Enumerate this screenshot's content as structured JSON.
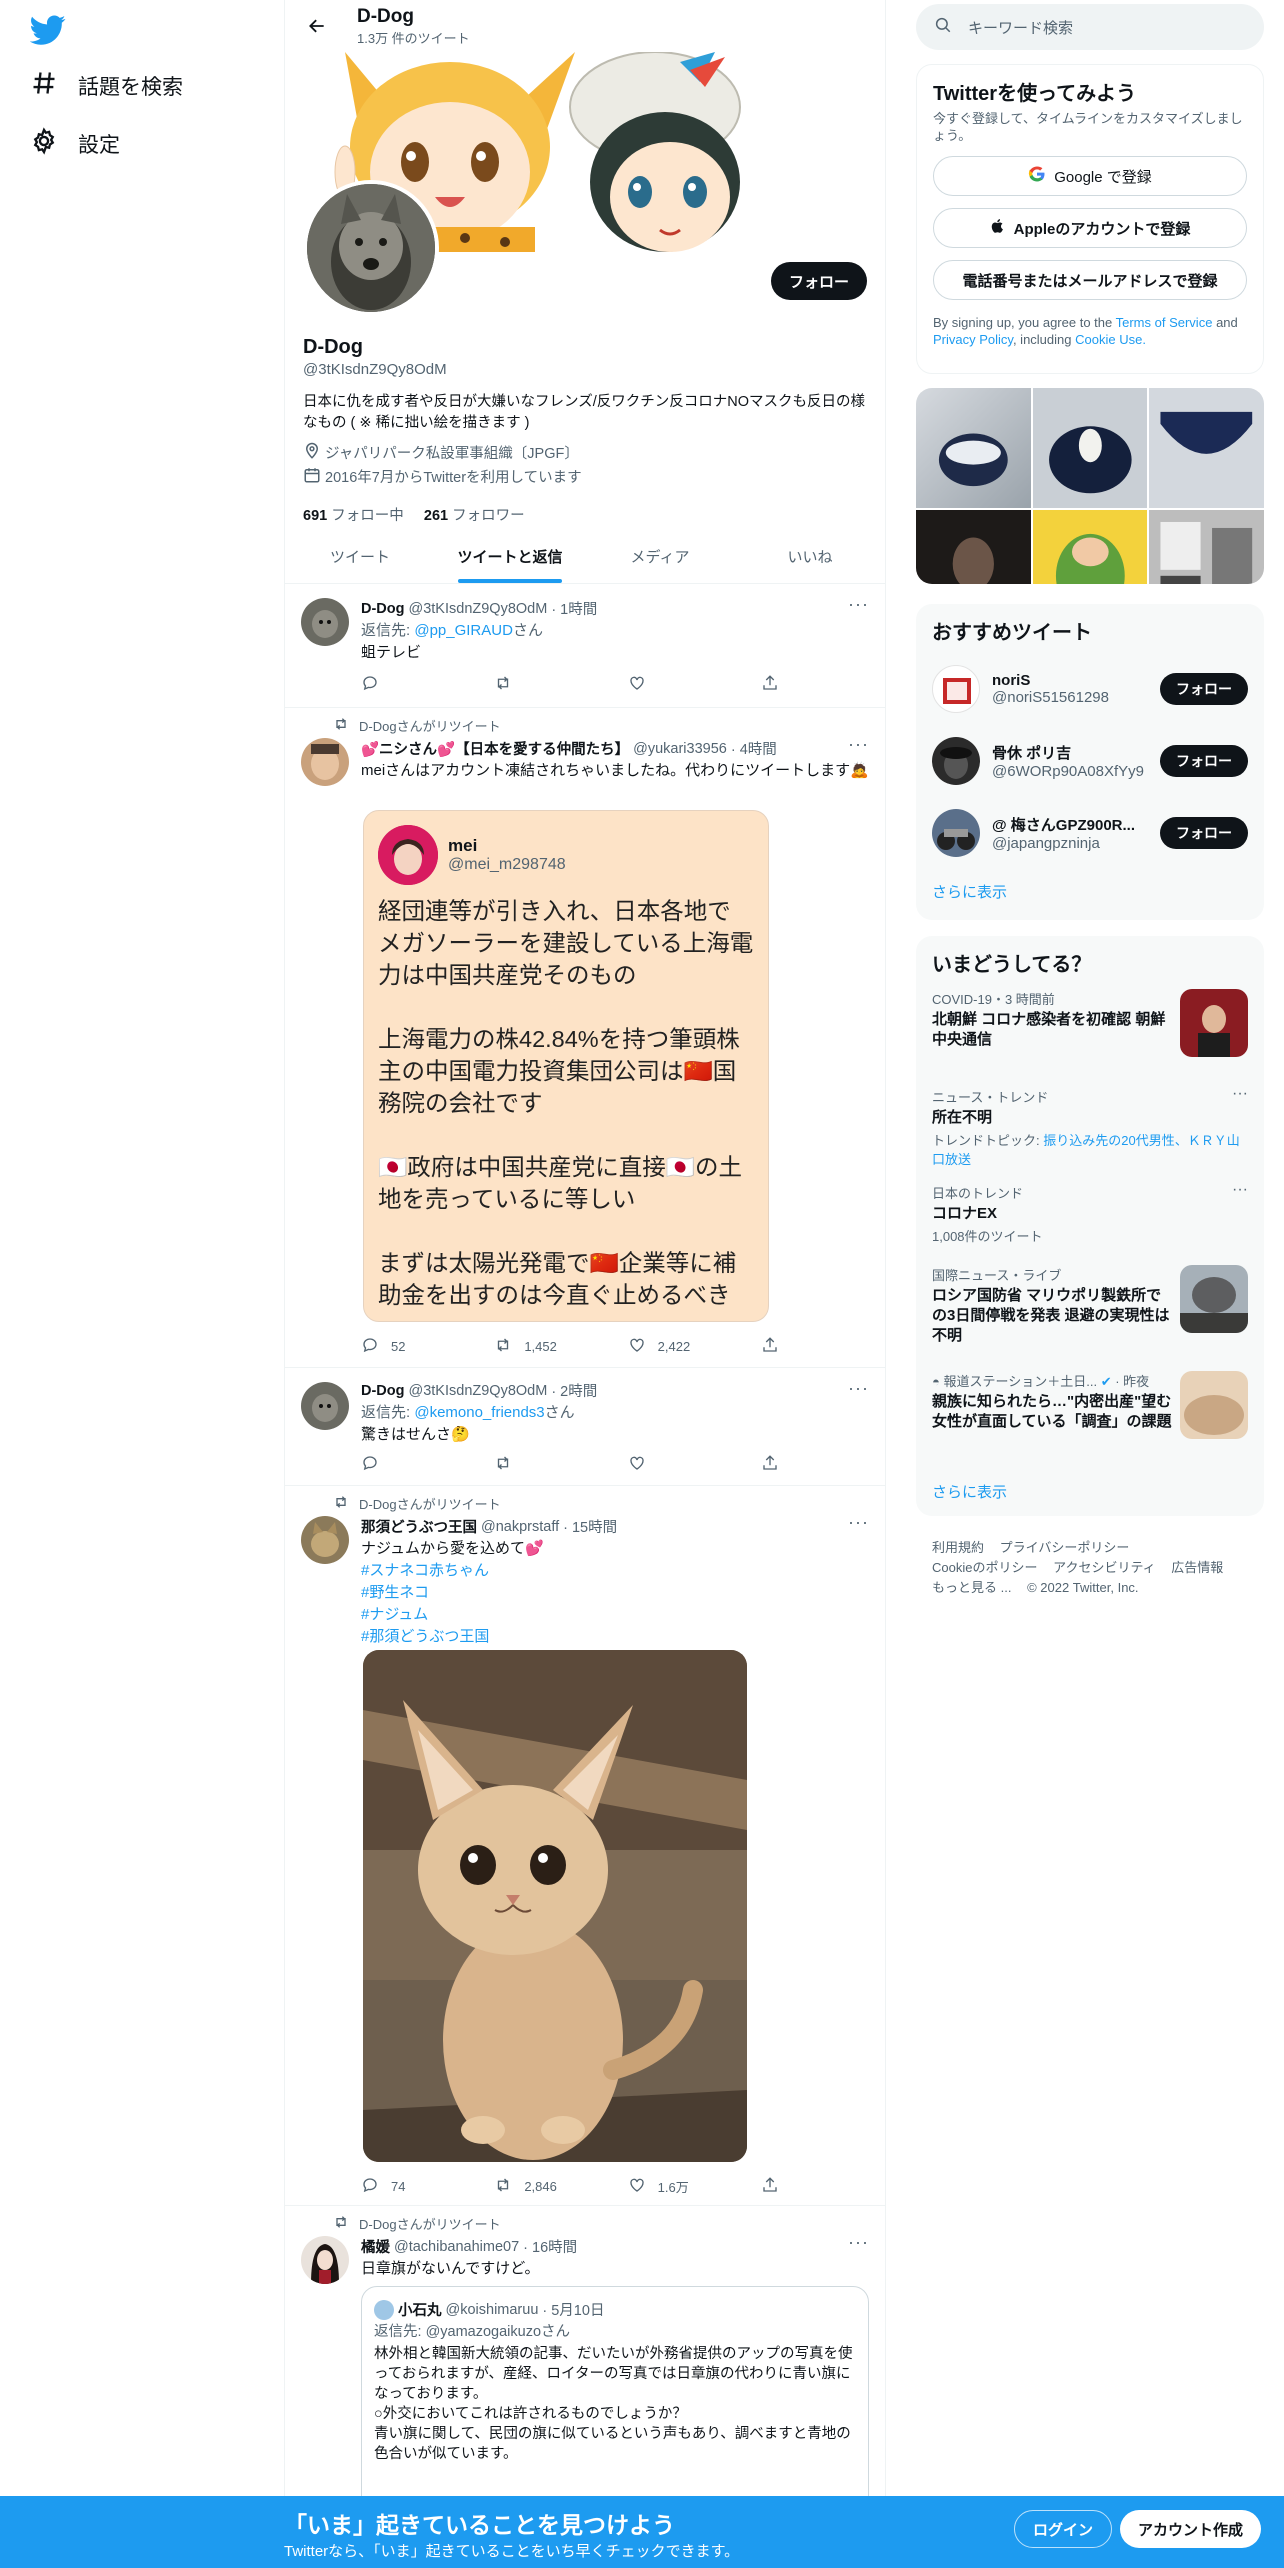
{
  "nav": {
    "explore_label": "話題を検索",
    "settings_label": "設定"
  },
  "profile": {
    "header_name": "D-Dog",
    "tweet_count": "1.3万 件のツイート",
    "name": "D-Dog",
    "handle": "@3tKIsdnZ9Qy8OdM",
    "follow_label": "フォロー",
    "bio": "日本に仇を成す者や反日が大嫌いなフレンズ/反ワクチン反コロナNOマスクも反日の様なもの ( ※ 稀に拙い絵を描きます )",
    "location": "ジャパリパーク私設軍事組織〔JPGF〕",
    "joined": "2016年7月からTwitterを利用しています",
    "following_count": "691",
    "following_label": "フォロー中",
    "followers_count": "261",
    "followers_label": "フォロワー"
  },
  "tabs": [
    "ツイート",
    "ツイートと返信",
    "メディア",
    "いいね"
  ],
  "tweets": [
    {
      "name": "D-Dog",
      "handle": "@3tKIsdnZ9Qy8OdM",
      "time": "· 1時間",
      "reply_prefix": "返信先:",
      "reply_to": "@pp_GIRAUD",
      "reply_suffix": "さん",
      "text": "蛆テレビ"
    },
    {
      "retweet_by": "D-Dogさんがリツイート",
      "name": "💕ニシさん💕【日本を愛する仲間たち】",
      "handle": "@yukari33956",
      "time": "· 4時間",
      "text": "meiさんはアカウント凍結されちゃいましたね。代わりにツイートします🙇",
      "embed_name": "mei",
      "embed_handle": "@mei_m298748",
      "embed_text_1": "経団連等が引き入れ、日本各地でメガソーラーを建設している上海電力は中国共産党そのもの",
      "embed_text_2": "上海電力の株42.84%を持つ筆頭株主の中国電力投資集団公司は🇨🇳国務院の会社です",
      "embed_text_3": "🇯🇵政府は中国共産党に直接🇯🇵の土地を売っているに等しい",
      "embed_text_4": "まずは太陽光発電で🇨🇳企業等に補助金を出すのは今直ぐ止めるべき",
      "replies": "52",
      "retweets": "1,452",
      "likes": "2,422"
    },
    {
      "name": "D-Dog",
      "handle": "@3tKIsdnZ9Qy8OdM",
      "time": "· 2時間",
      "reply_prefix": "返信先:",
      "reply_to": "@kemono_friends3",
      "reply_suffix": "さん",
      "text": "驚きはせんさ🤔"
    },
    {
      "retweet_by": "D-Dogさんがリツイート",
      "name": "那須どうぶつ王国",
      "handle": "@nakprstaff",
      "time": "· 15時間",
      "text": "ナジュムから愛を込めて💕",
      "hashtags": [
        "#スナネコ赤ちゃん",
        "#野生ネコ",
        "#ナジュム",
        "#那須どうぶつ王国"
      ],
      "replies": "74",
      "retweets": "2,846",
      "likes": "1.6万"
    },
    {
      "retweet_by": "D-Dogさんがリツイート",
      "name": "橘媛",
      "handle": "@tachibanahime07",
      "time": "· 16時間",
      "text": "日章旗がないんですけど。",
      "quote_name": "小石丸",
      "quote_handle": "@koishimaruu",
      "quote_time": "· 5月10日",
      "quote_reply_prefix": "返信先:",
      "quote_reply_to": "@yamazogaikuzo",
      "quote_reply_suffix": "さん",
      "quote_text": "林外相と韓国新大統領の記事、だいたいが外務省提供のアップの写真を使っておられますが、産経、ロイターの写真では日章旗の代わりに青い旗になっております。\n○外交においてこれは許されるものでしょうか？\n青い旗に関して、民団の旗に似ているという声もあり、調べますと青地の色合いが似ています。"
    }
  ],
  "right": {
    "search_placeholder": "キーワード検索",
    "signup_title": "Twitterを使ってみよう",
    "signup_sub": "今すぐ登録して、タイムラインをカスタマイズしましょう。",
    "google_label": "Google で登録",
    "apple_label": "Appleのアカウントで登録",
    "phone_label": "電話番号またはメールアドレスで登録",
    "terms_prefix": "By signing up, you agree to the",
    "terms_link": "Terms of Service",
    "terms_and": "and",
    "privacy_link": "Privacy Policy",
    "including": ", including",
    "cookie_link": "Cookie Use.",
    "who_title": "おすすめツイート",
    "who": [
      {
        "name": "noriS",
        "handle": "@noriS51561298",
        "follow": "フォロー"
      },
      {
        "name": "骨休 ポリ吉",
        "handle": "@6WORp90A08XfYy9",
        "follow": "フォロー"
      },
      {
        "name": "@ 梅さんGPZ900R...",
        "handle": "@japangpzninja",
        "follow": "フォロー"
      }
    ],
    "show_more": "さらに表示",
    "trends_title": "いまどうしてる？",
    "trends": [
      {
        "meta": "COVID-19・3 時間前",
        "title": "北朝鮮 コロナ感染者を初確認 朝鮮中央通信"
      },
      {
        "meta": "ニュース・トレンド",
        "title": "所在不明",
        "sub_prefix": "トレンドトピック:",
        "sub_link": "振り込み先の20代男性、ＫＲＹ山口放送"
      },
      {
        "meta": "日本のトレンド",
        "title": "コロナEX",
        "sub": "1,008件のツイート"
      },
      {
        "meta": "国際ニュース・ライブ",
        "title": "ロシア国防省 マリウポリ製鉄所での3日間停戦を発表 退避の実現性は不明"
      },
      {
        "meta": "報道ステーション＋土日...",
        "meta_time": "· 昨夜",
        "title": "親族に知られたら…\"内密出産\"望む女性が直面している「調査」の課題"
      }
    ],
    "trends_more": "さらに表示",
    "footer": [
      "利用規約",
      "プライバシーポリシー",
      "Cookieのポリシー",
      "アクセシビリティ",
      "広告情報",
      "もっと見る ...",
      "© 2022 Twitter, Inc."
    ]
  },
  "bottom": {
    "title": "「いま」起きていることを見つけよう",
    "subtitle": "Twitterなら、「いま」起きていることをいち早くチェックできます。",
    "login": "ログイン",
    "signup": "アカウント作成"
  }
}
